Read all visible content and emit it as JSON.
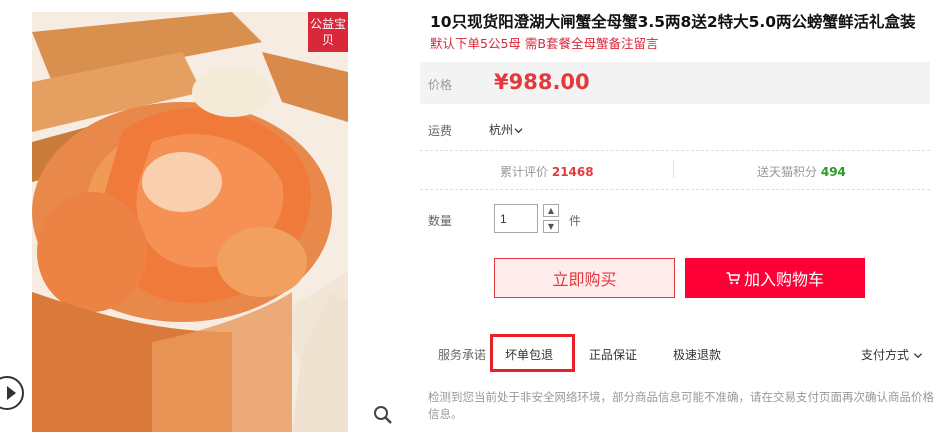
{
  "product": {
    "badge": "公益宝贝",
    "title": "10只现货阳澄湖大闸蟹全母蟹3.5两8送2特大5.0两公螃蟹鲜活礼盒装",
    "subtitle": "默认下单5公5母 需B套餐全母蟹备注留言"
  },
  "price": {
    "label": "价格",
    "value": "¥988.00"
  },
  "shipping": {
    "label": "运费",
    "from": "杭州"
  },
  "stats": {
    "reviews_label": "累计评价",
    "reviews_count": "21468",
    "points_label": "送天猫积分",
    "points_count": "494"
  },
  "quantity": {
    "label": "数量",
    "value": "1",
    "unit": "件"
  },
  "actions": {
    "buy_now": "立即购买",
    "add_to_cart": "加入购物车"
  },
  "services": {
    "label": "服务承诺",
    "items": [
      "坏单包退",
      "正品保证",
      "极速退款"
    ],
    "payment": "支付方式"
  },
  "notice": "检测到您当前处于非安全网络环境，部分商品信息可能不准确，请在交易支付页面再次确认商品价格信息。",
  "colors": {
    "accent": "#ff0036",
    "price": "#e4393c",
    "points": "#279b22",
    "highlight": "#e8202c"
  },
  "icons": [
    "play-icon",
    "zoom-icon",
    "chevron-down-icon",
    "cart-icon"
  ]
}
